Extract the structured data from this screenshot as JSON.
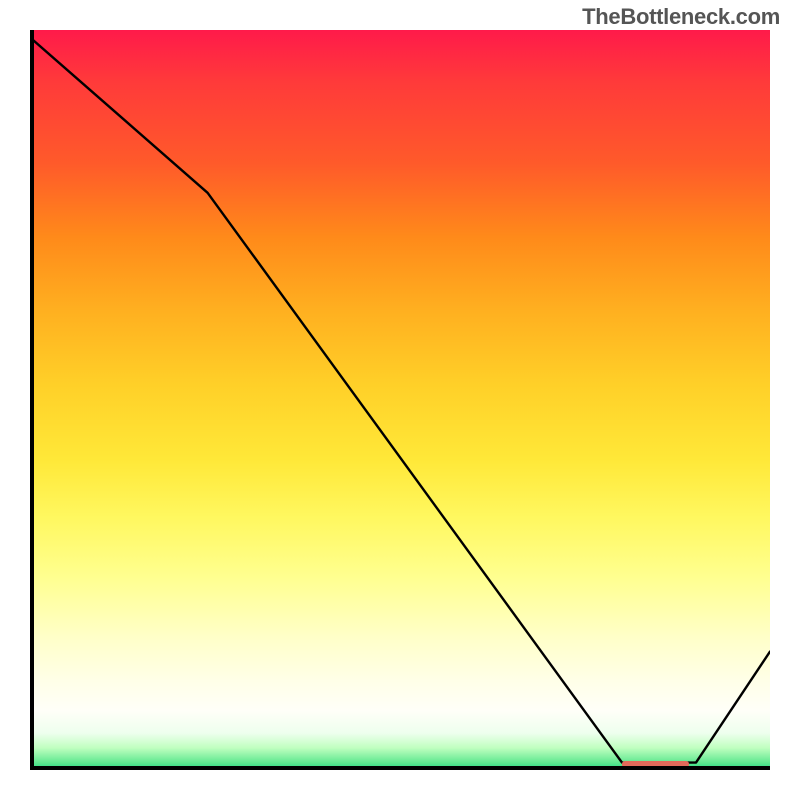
{
  "attribution": "TheBottleneck.com",
  "chart_data": {
    "type": "line",
    "title": "",
    "xlabel": "",
    "ylabel": "",
    "x_range": [
      0,
      100
    ],
    "y_range": [
      0,
      100
    ],
    "series": [
      {
        "name": "curve",
        "x": [
          0,
          24,
          80,
          90,
          100
        ],
        "y": [
          99,
          78,
          1,
          1,
          16
        ]
      }
    ],
    "marker": {
      "x_start": 80,
      "x_end": 89,
      "y": 0.8,
      "color": "#e26a5a"
    },
    "gradient_stops": [
      {
        "pos": 0.0,
        "color": "#ff1a4a"
      },
      {
        "pos": 0.07,
        "color": "#ff3a3a"
      },
      {
        "pos": 0.18,
        "color": "#ff5a2a"
      },
      {
        "pos": 0.28,
        "color": "#ff8a1a"
      },
      {
        "pos": 0.38,
        "color": "#ffb020"
      },
      {
        "pos": 0.48,
        "color": "#ffd028"
      },
      {
        "pos": 0.58,
        "color": "#ffe838"
      },
      {
        "pos": 0.66,
        "color": "#fff860"
      },
      {
        "pos": 0.74,
        "color": "#ffff90"
      },
      {
        "pos": 0.82,
        "color": "#ffffc8"
      },
      {
        "pos": 0.88,
        "color": "#ffffe8"
      },
      {
        "pos": 0.92,
        "color": "#fffff8"
      },
      {
        "pos": 0.95,
        "color": "#eeffee"
      },
      {
        "pos": 0.97,
        "color": "#c0ffc0"
      },
      {
        "pos": 0.99,
        "color": "#60e890"
      },
      {
        "pos": 1.0,
        "color": "#20d880"
      }
    ]
  }
}
